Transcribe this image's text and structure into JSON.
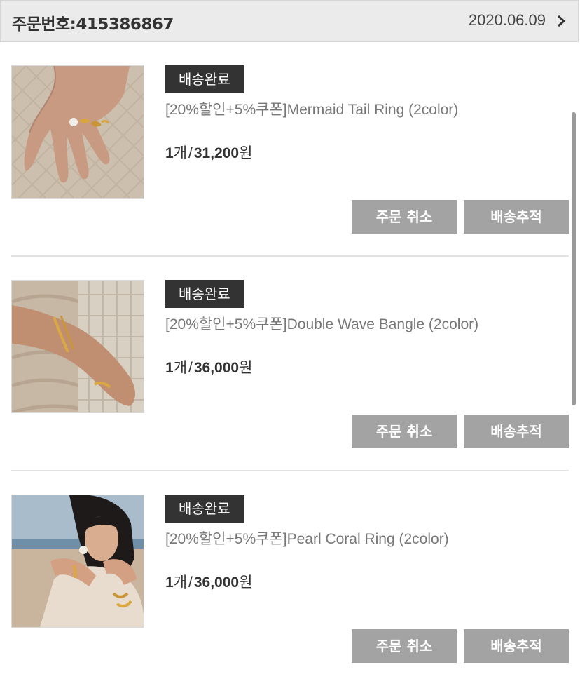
{
  "header": {
    "order_label": "주문번호:",
    "order_number": "415386867",
    "date": "2020.06.09",
    "chevron_icon": "chevron-right-icon"
  },
  "items": [
    {
      "status": "배송완료",
      "name": "[20%할인+5%쿠폰]Mermaid Tail Ring (2color)",
      "qty": "1",
      "qty_unit": "개",
      "price": "31,200",
      "currency": "원",
      "cancel_label": "주문 취소",
      "track_label": "배송추적"
    },
    {
      "status": "배송완료",
      "name": "[20%할인+5%쿠폰]Double Wave Bangle (2color)",
      "qty": "1",
      "qty_unit": "개",
      "price": "36,000",
      "currency": "원",
      "cancel_label": "주문 취소",
      "track_label": "배송추적"
    },
    {
      "status": "배송완료",
      "name": "[20%할인+5%쿠폰]Pearl Coral Ring (2color)",
      "qty": "1",
      "qty_unit": "개",
      "price": "36,000",
      "currency": "원",
      "cancel_label": "주문 취소",
      "track_label": "배송추적"
    }
  ],
  "colors": {
    "header_bg": "#ebebeb",
    "badge_bg": "#333333",
    "button_bg": "#a3a3a3"
  }
}
